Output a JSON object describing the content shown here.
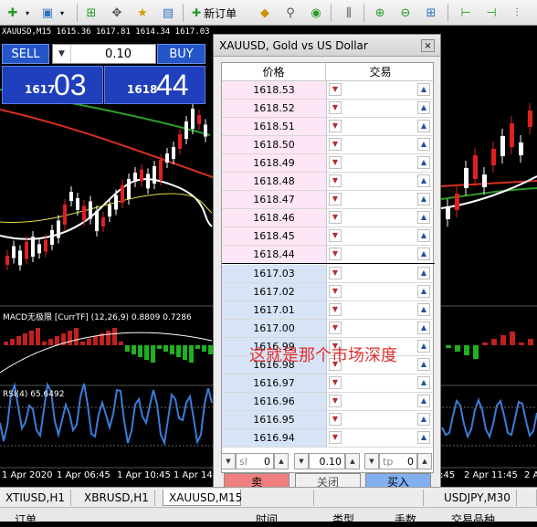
{
  "toolbar": {
    "new_order_label": "新订单",
    "icons": [
      "plus-chart-icon",
      "profiles-icon",
      "chart-bars-icon",
      "crosshair-icon",
      "favorites-icon",
      "navigator-icon",
      "terminal-icon",
      "gold-bar-icon",
      "search-icon",
      "signal-icon",
      "period-icon",
      "zoom-in-icon",
      "zoom-out-icon",
      "tile-icon",
      "autoscroll-icon",
      "chart-shift-icon"
    ]
  },
  "chart": {
    "header": "XAUUSD,M15  1615.36 1617.81 1614.34 1617.03",
    "macd_label": "MACD无极限 [CurrTF] (12,26,9) 0.8809 0.7286",
    "rsi_label": "RSI(4) 65.6492",
    "x_ticks_left": [
      "1 Apr 2020",
      "1 Apr 06:45",
      "1 Apr 10:45",
      "1 Apr 14"
    ],
    "x_ticks_right": [
      ":45",
      "2 Apr 11:45",
      "2 A"
    ],
    "colors": {
      "bull": "#ffffff",
      "bear": "#e02020",
      "ma_red": "#d83020",
      "ma_green": "#2aa02a",
      "ma_yellow": "#e0e040",
      "rsi": "#3a7dd8"
    }
  },
  "one_click": {
    "sell_label": "SELL",
    "buy_label": "BUY",
    "lot": "0.10",
    "sell_small": "1617",
    "sell_big": "03",
    "buy_small": "1618",
    "buy_big": "44"
  },
  "depth": {
    "title": "XAUUSD, Gold vs US Dollar",
    "close_glyph": "×",
    "col_price": "价格",
    "col_trade": "交易",
    "asks": [
      "1618.53",
      "1618.52",
      "1618.51",
      "1618.50",
      "1618.49",
      "1618.48",
      "1618.47",
      "1618.46",
      "1618.45",
      "1618.44"
    ],
    "bids": [
      "1617.03",
      "1617.02",
      "1617.01",
      "1617.00",
      "1616.99",
      "1616.98",
      "1616.97",
      "1616.96",
      "1616.95",
      "1616.94"
    ],
    "sl_label": "sl",
    "sl_value": "0",
    "lot_value": "0.10",
    "tp_label": "tp",
    "tp_value": "0",
    "sell_label": "卖",
    "close_label": "关闭",
    "buy_label": "买入",
    "colors": {
      "sell_btn": "#f08080",
      "buy_btn": "#80b0f0"
    }
  },
  "annotation": "这就是那个市场深度",
  "tabs": [
    "XTIUSD,H1",
    "XBRUSD,H1",
    "XAUUSD,M15",
    "",
    "",
    "USDJPY,M30",
    ""
  ],
  "bottom": {
    "order": "订单",
    "time": "时间",
    "type": "类型",
    "lots": "手数",
    "symbol": "交易品种"
  }
}
